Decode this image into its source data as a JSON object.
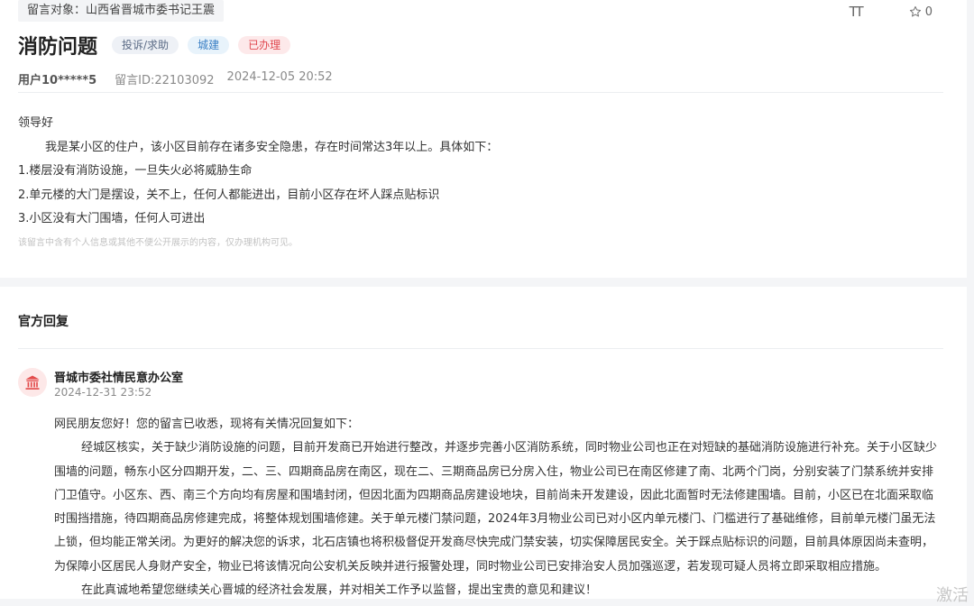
{
  "message": {
    "target_tag": "留言对象：山西省晋城市委书记王震",
    "font_size_icon": "TT",
    "favorite_count": "0",
    "title": "消防问题",
    "tags": [
      "投诉/求助",
      "城建",
      "已办理"
    ],
    "user": "用户10*****5",
    "message_id": "留言ID:22103092",
    "datetime": "2024-12-05 20:52",
    "paragraphs": [
      "领导好",
      "我是某小区的住户，该小区目前存在诸多安全隐患，存在时间常达3年以上。具体如下：",
      "1.楼层没有消防设施，一旦失火必将威胁生命",
      "2.单元楼的大门是摆设，关不上，任何人都能进出，目前小区存在坏人踩点贴标识",
      "3.小区没有大门围墙，任何人可进出"
    ],
    "privacy_notice": "该留言中含有个人信息或其他不便公开展示的内容，仅办理机构可见。"
  },
  "reply": {
    "heading": "官方回复",
    "org_name": "晋城市委社情民意办公室",
    "datetime": "2024-12-31 23:52",
    "paragraphs": [
      "网民朋友您好！您的留言已收悉，现将有关情况回复如下：",
      "经城区核实，关于缺少消防设施的问题，目前开发商已开始进行整改，并逐步完善小区消防系统，同时物业公司也正在对短缺的基础消防设施进行补充。关于小区缺少围墙的问题，畅东小区分四期开发，二、三、四期商品房在南区，现在二、三期商品房已分房入住，物业公司已在南区修建了南、北两个门岗，分别安装了门禁系统并安排门卫值守。小区东、西、南三个方向均有房屋和围墙封闭，但因北面为四期商品房建设地块，目前尚未开发建设，因此北面暂时无法修建围墙。目前，小区已在北面采取临时围挡措施，待四期商品房修建完成，将整体规划围墙修建。关于单元楼门禁问题，2024年3月物业公司已对小区内单元楼门、门槛进行了基础维修，目前单元楼门虽无法上锁，但均能正常关闭。为更好的解决您的诉求，北石店镇也将积极督促开发商尽快完成门禁安装，切实保障居民安全。关于踩点贴标识的问题，目前具体原因尚未查明，为保障小区居民人身财产安全，物业已将该情况向公安机关反映并进行报警处理，同时物业公司已安排治安人员加强巡逻，若发现可疑人员将立即采取相应措施。",
      "在此真诚地希望您继续关心晋城的经济社会发展，并对相关工作予以监督，提出宝贵的意见和建议！"
    ]
  },
  "watermark": "激活",
  "colors": {
    "status_red": "#e0484f",
    "field_blue": "#3a7fc4",
    "logo_red": "#e34b4b"
  },
  "icons": [
    "star-icon",
    "font-size-icon",
    "government-building-icon"
  ]
}
